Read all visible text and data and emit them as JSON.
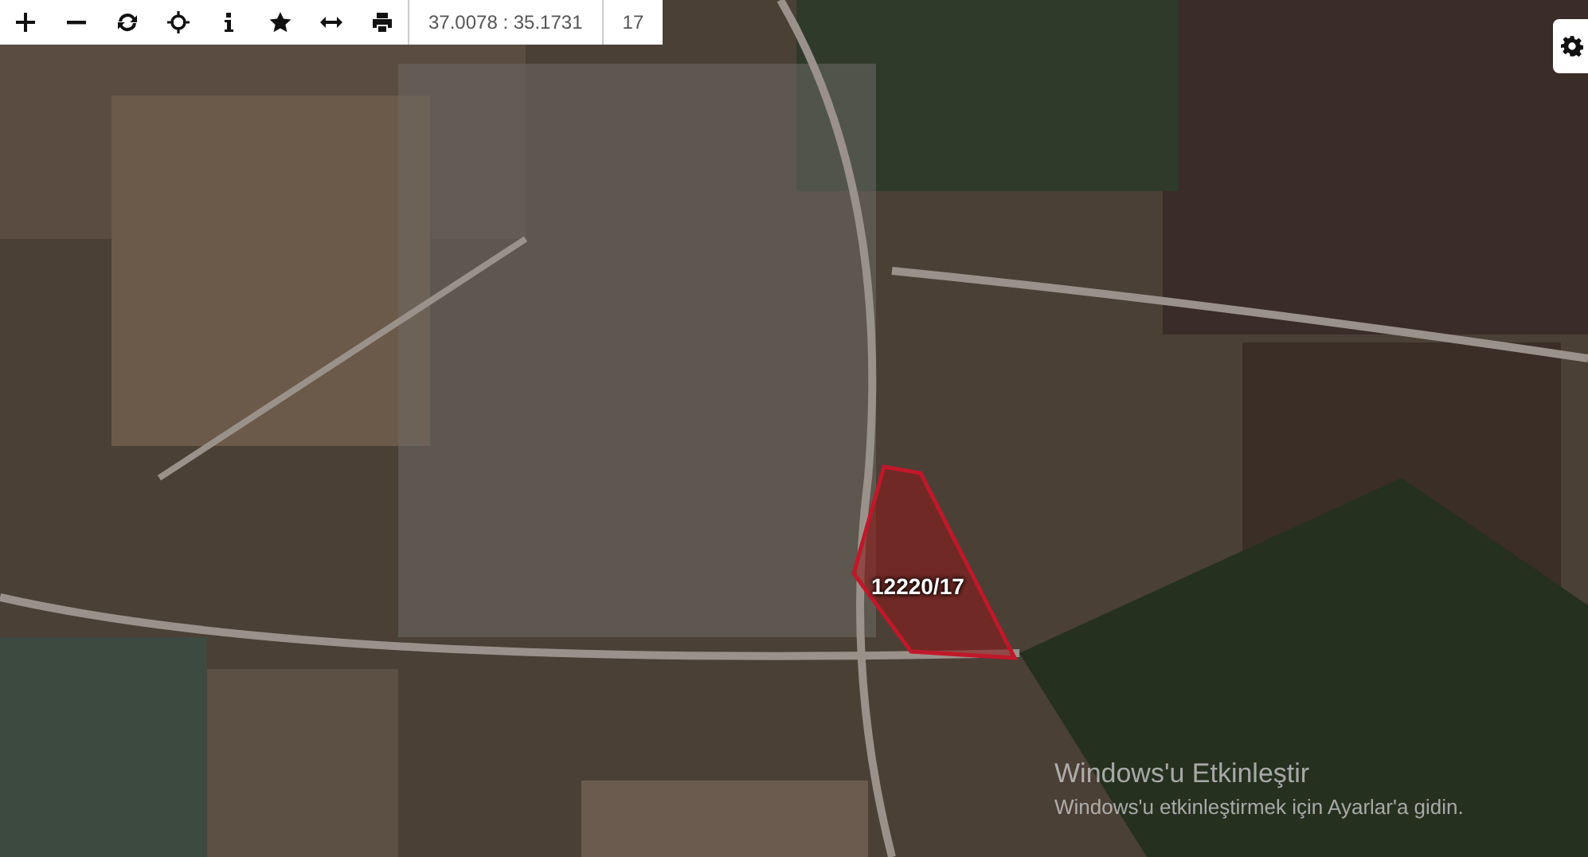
{
  "toolbar": {
    "tools": [
      {
        "kind": "zoom-in"
      },
      {
        "kind": "zoom-out"
      },
      {
        "kind": "refresh"
      },
      {
        "kind": "locate"
      },
      {
        "kind": "info"
      },
      {
        "kind": "star"
      },
      {
        "kind": "measure"
      },
      {
        "kind": "print"
      }
    ],
    "coordinates": "37.0078 : 35.1731",
    "zoom": "17"
  },
  "map": {
    "parcel": {
      "label": "12220/17"
    }
  },
  "activation_notice": {
    "title": "Windows'u Etkinleştir",
    "message": "Windows'u etkinleştirmek için Ayarlar'a gidin."
  }
}
